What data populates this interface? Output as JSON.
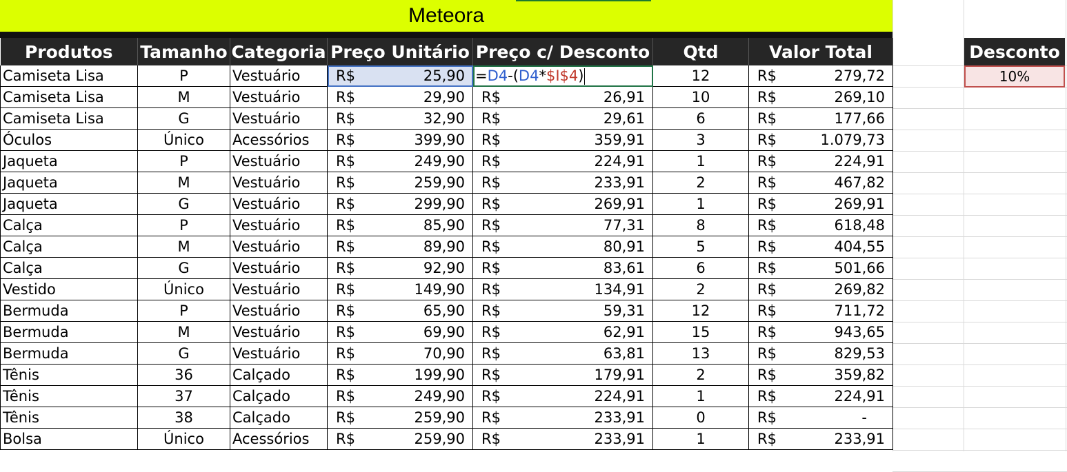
{
  "title": "Meteora",
  "headers": [
    "Produtos",
    "Tamanho",
    "Categoria",
    "Preço Unitário",
    "Preço c/ Desconto",
    "Qtd",
    "Valor Total"
  ],
  "currency": "R$",
  "rows": [
    {
      "produto": "Camiseta Lisa",
      "tamanho": "P",
      "categoria": "Vestuário",
      "preco": "25,90",
      "desconto": "",
      "qtd": "12",
      "total": "279,72"
    },
    {
      "produto": "Camiseta Lisa",
      "tamanho": "M",
      "categoria": "Vestuário",
      "preco": "29,90",
      "desconto": "26,91",
      "qtd": "10",
      "total": "269,10"
    },
    {
      "produto": "Camiseta Lisa",
      "tamanho": "G",
      "categoria": "Vestuário",
      "preco": "32,90",
      "desconto": "29,61",
      "qtd": "6",
      "total": "177,66"
    },
    {
      "produto": "Óculos",
      "tamanho": "Único",
      "categoria": "Acessórios",
      "preco": "399,90",
      "desconto": "359,91",
      "qtd": "3",
      "total": "1.079,73"
    },
    {
      "produto": "Jaqueta",
      "tamanho": "P",
      "categoria": "Vestuário",
      "preco": "249,90",
      "desconto": "224,91",
      "qtd": "1",
      "total": "224,91"
    },
    {
      "produto": "Jaqueta",
      "tamanho": "M",
      "categoria": "Vestuário",
      "preco": "259,90",
      "desconto": "233,91",
      "qtd": "2",
      "total": "467,82"
    },
    {
      "produto": "Jaqueta",
      "tamanho": "G",
      "categoria": "Vestuário",
      "preco": "299,90",
      "desconto": "269,91",
      "qtd": "1",
      "total": "269,91"
    },
    {
      "produto": "Calça",
      "tamanho": "P",
      "categoria": "Vestuário",
      "preco": "85,90",
      "desconto": "77,31",
      "qtd": "8",
      "total": "618,48"
    },
    {
      "produto": "Calça",
      "tamanho": "M",
      "categoria": "Vestuário",
      "preco": "89,90",
      "desconto": "80,91",
      "qtd": "5",
      "total": "404,55"
    },
    {
      "produto": "Calça",
      "tamanho": "G",
      "categoria": "Vestuário",
      "preco": "92,90",
      "desconto": "83,61",
      "qtd": "6",
      "total": "501,66"
    },
    {
      "produto": "Vestido",
      "tamanho": "Único",
      "categoria": "Vestuário",
      "preco": "149,90",
      "desconto": "134,91",
      "qtd": "2",
      "total": "269,82"
    },
    {
      "produto": "Bermuda",
      "tamanho": "P",
      "categoria": "Vestuário",
      "preco": "65,90",
      "desconto": "59,31",
      "qtd": "12",
      "total": "711,72"
    },
    {
      "produto": "Bermuda",
      "tamanho": "M",
      "categoria": "Vestuário",
      "preco": "69,90",
      "desconto": "62,91",
      "qtd": "15",
      "total": "943,65"
    },
    {
      "produto": "Bermuda",
      "tamanho": "G",
      "categoria": "Vestuário",
      "preco": "70,90",
      "desconto": "63,81",
      "qtd": "13",
      "total": "829,53"
    },
    {
      "produto": "Tênis",
      "tamanho": "36",
      "categoria": "Calçado",
      "preco": "199,90",
      "desconto": "179,91",
      "qtd": "2",
      "total": "359,82"
    },
    {
      "produto": "Tênis",
      "tamanho": "37",
      "categoria": "Calçado",
      "preco": "249,90",
      "desconto": "224,91",
      "qtd": "1",
      "total": "224,91"
    },
    {
      "produto": "Tênis",
      "tamanho": "38",
      "categoria": "Calçado",
      "preco": "259,90",
      "desconto": "233,91",
      "qtd": "0",
      "total": "-"
    },
    {
      "produto": "Bolsa",
      "tamanho": "Único",
      "categoria": "Acessórios",
      "preco": "259,90",
      "desconto": "233,91",
      "qtd": "1",
      "total": "233,91"
    }
  ],
  "editing_formula": {
    "prefix": "=",
    "ref1": "D4",
    "op1": "-(",
    "ref2": "D4",
    "op2": "*",
    "ref3": "$I$4",
    "suffix": ")"
  },
  "desconto": {
    "label": "Desconto",
    "value": "10%"
  },
  "colors": {
    "title_bg": "#dcff00",
    "header_bg": "#262626",
    "selected_bg": "#d9e1f2",
    "discount_cell_bg": "#f8e4e4"
  }
}
